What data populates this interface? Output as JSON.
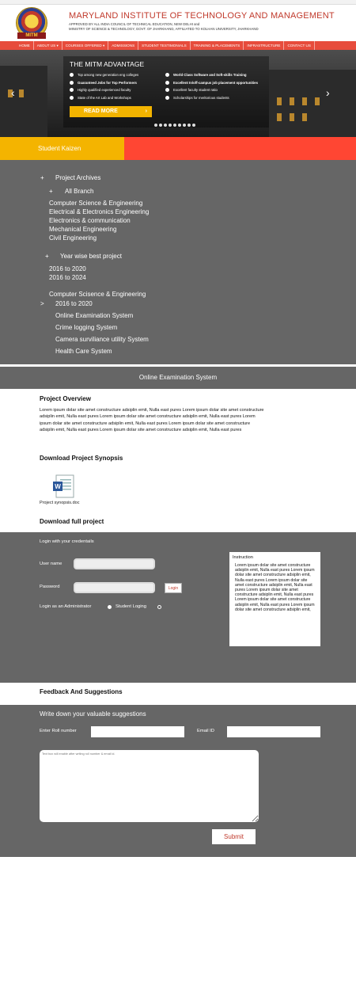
{
  "header": {
    "institute_name": "MARYLAND INSTITUTE OF TECHNOLOGY AND MANAGEMENT",
    "approval_line1": "APPROVED BY ALL INDIA COUNCIL OF TECHNICAL EDUCATION, NEW DELHI and",
    "approval_line2": "MINISTRY OF SCIENCE & TECHNOLOGY, GOVT. OF JHARKHAND, AFFILIATED TO KOLHAN UNIVERSITY, JHARKHAND",
    "logo_text": "MITM"
  },
  "nav": {
    "items": [
      "HOME",
      "ABOUT US ▾",
      "COURSES OFFERED ▾",
      "ADMISSIONS",
      "STUDENT TESTIMONIALS",
      "TRAINING & PLACEMENTS",
      "INFRASTRUCTURE",
      "CONTACT US"
    ]
  },
  "banner": {
    "title": "THE MITM ADVANTAGE",
    "left_points": [
      "Top among new generation eng colleges",
      "Guaranteed Jobs for Top Performers",
      "Highly qualified experienced faculty",
      "State of the Art Lab and Workshops"
    ],
    "right_points": [
      "World Class Software and Soft-skills Training",
      "Excellent In/off-campus job placement opportunities",
      "Excellent faculty student ratio",
      "Scholarships for meritorious students"
    ],
    "read_more": "READ MORE",
    "read_more_arrow": "›",
    "prev_arrow": "‹",
    "next_arrow": "›"
  },
  "kaizen": {
    "label": "Student Kaizen"
  },
  "archive": {
    "archives_toggle": "+",
    "archives_label": "Project Archives",
    "branch_toggle": "+",
    "branch_label": "All Branch",
    "branches": [
      "Computer Science & Engineering",
      "Electrical & Electronics Engineering",
      "Electronics & communication",
      "Mechanical Engineering",
      "Civil Engineering"
    ],
    "year_toggle": "+",
    "year_label": "Year wise best project",
    "years": [
      "2016 to 2020",
      "2016 to 2024"
    ],
    "selected_branch": "Computer Scisence & Engineering",
    "selected_marker": ">",
    "selected_year": "2016 to 2020",
    "projects": [
      "Online Examination System",
      "Crime logging System",
      "Camera surviliance utility System",
      "Health Care System"
    ]
  },
  "project": {
    "title": "Online Examination System",
    "overview_heading": "Project Overview",
    "overview_text": "Lorem ipsum dolar site amet constructure adsiplin emit, Nulla east pures Lorem ipsum dolar site amet constructure adsiplin emit, Nulla east pures Lorem ipsum dolar site amet constructure adsiplin emit, Nulla east pures Lorem ipsum dolar site amet constructure adsiplin emit, Nulla east pures Lorem ipsum dolar site amet constructure adsiplin emit, Nulla east pures Lorem ipsum dolar site amet constructure adsiplin emit, Nulla east pures",
    "synopsis_heading": "Download Project Synopsis",
    "synopsis_file": "Project synopsis.doc",
    "full_heading": "Download full project"
  },
  "login": {
    "heading": "Login with your credentails",
    "username_label": "User name",
    "password_label": "Password",
    "login_button": "Login",
    "admin_option": "Login as an Administrator",
    "student_option": "Student Loging",
    "instruction_title": "Instruction",
    "instruction_text": "Lorem ipsum dolar site amet constructure adsiplin emit, Nulla east pures Lorem ipsum dolar site amet constructure adsiplin emit, Nulla east pures Lorem ipsum dolar site amet constructure adsiplin emit, Nulla east pures Lorem ipsum dolar site amet constructure adsiplin emit, Nulla east pures Lorem ipsum dolar site amet constructure adsiplin emit, Nulla east pures Lorem ipsum dolar site amet constructure adsiplin emit,"
  },
  "feedback": {
    "heading": "Feedback And Suggestions",
    "box_title": "Write down your valuable suggestions",
    "roll_label": "Enter Roll number",
    "email_label": "Email ID",
    "textarea_placeholder": "Text box will enable after writing roll number & email id.",
    "submit": "Submit"
  },
  "colors": {
    "accent_red": "#ff4633",
    "accent_yellow": "#f4b400",
    "panel_gray": "#666666",
    "brand_red": "#c0392b"
  }
}
